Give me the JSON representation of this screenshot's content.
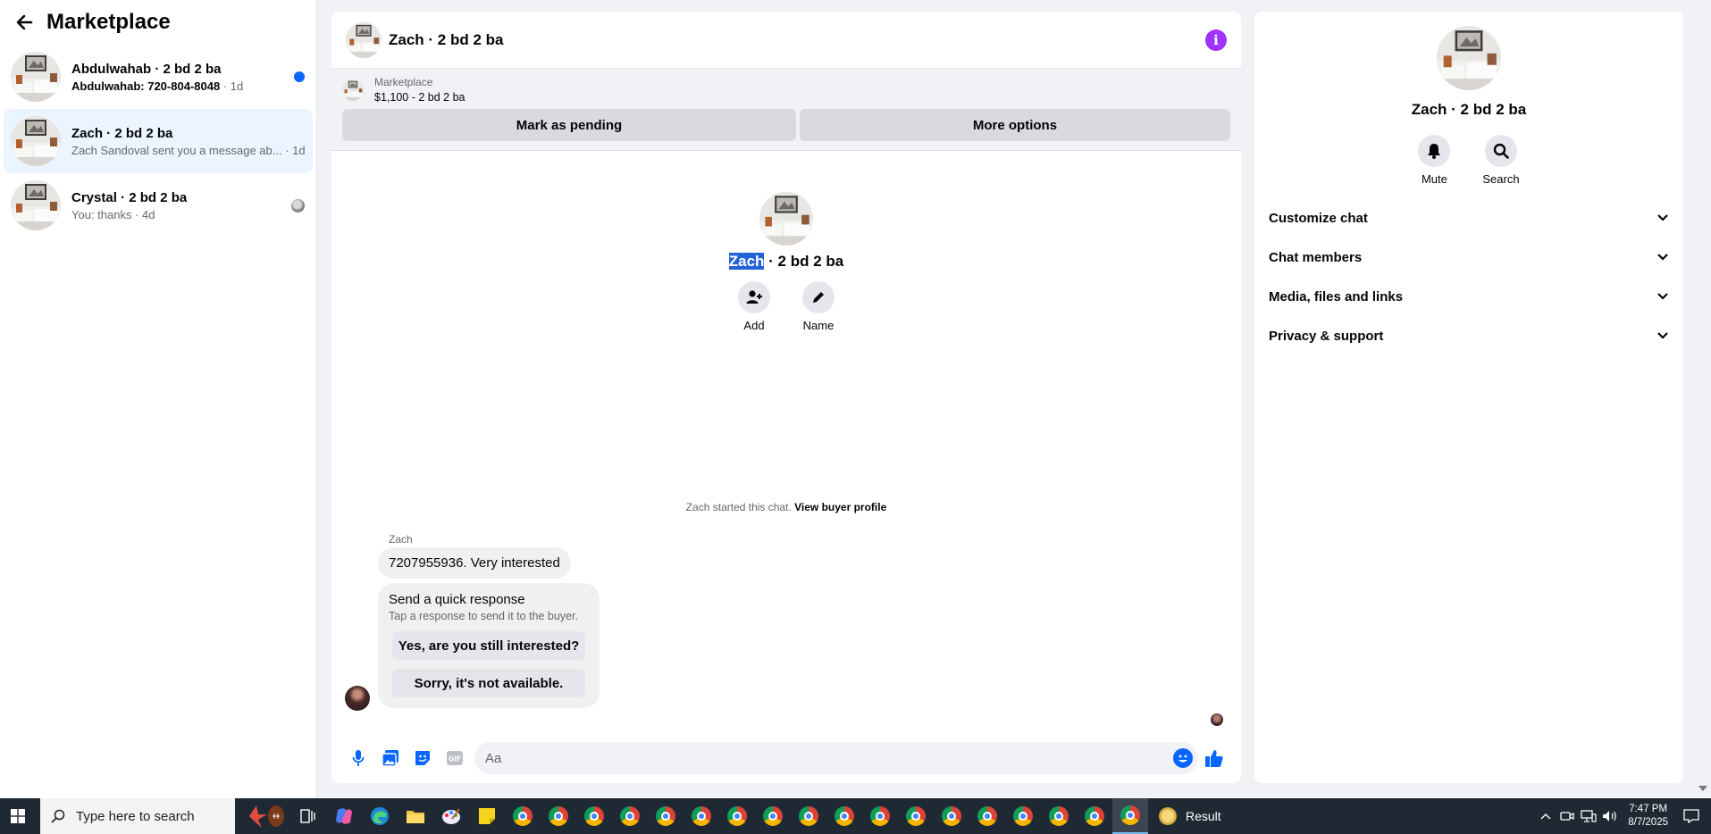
{
  "sidebar": {
    "title": "Marketplace",
    "conversations": [
      {
        "name": "Abdulwahab · 2 bd 2 ba",
        "preview": "Abdulwahab: 720-804-8048",
        "time": "1d"
      },
      {
        "name": "Zach · 2 bd 2 ba",
        "preview": "Zach Sandoval sent you a message ab...",
        "time": "1d"
      },
      {
        "name": "Crystal · 2 bd 2 ba",
        "preview": "You: thanks",
        "time": "4d"
      }
    ]
  },
  "chat": {
    "title": "Zach · 2 bd 2 ba",
    "listing": {
      "label": "Marketplace",
      "price": "$1,100 - 2 bd 2 ba"
    },
    "buttons": {
      "pending": "Mark as pending",
      "more": "More options"
    },
    "intro": {
      "highlight": "Zach",
      "rest": " · 2 bd 2 ba",
      "add": "Add",
      "name": "Name"
    },
    "started_text": "Zach started this chat.",
    "started_link": "View buyer profile",
    "sender": "Zach",
    "message": "7207955936. Very interested",
    "quick": {
      "title": "Send a quick response",
      "subtitle": "Tap a response to send it to the buyer.",
      "options": [
        "Yes, are you still interested?",
        "Sorry, it's not available."
      ]
    },
    "composer_placeholder": "Aa",
    "accent": "#0866ff"
  },
  "info": {
    "name": "Zach · 2 bd 2 ba",
    "mute": "Mute",
    "search": "Search",
    "sections": [
      "Customize chat",
      "Chat members",
      "Media, files and links",
      "Privacy & support"
    ]
  },
  "taskbar": {
    "search_placeholder": "Type here to search",
    "result": "Result",
    "time": "7:47 PM",
    "date": "8/7/2025"
  }
}
